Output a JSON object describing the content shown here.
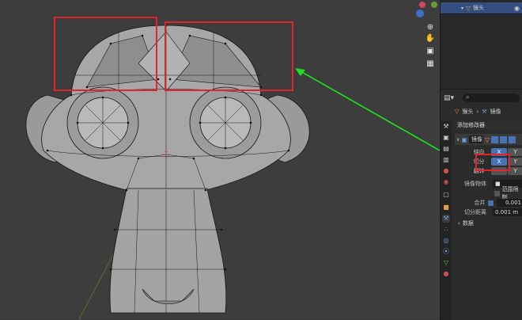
{
  "outliner": {
    "row_label": "猴头"
  },
  "properties": {
    "breadcrumb": {
      "object": "猴头",
      "modifier": "镜像"
    },
    "add_modifier_label": "添加修改器",
    "modifier": {
      "name": "镜像",
      "rows": {
        "axis": {
          "label": "轴向",
          "x": "X",
          "y": "Y"
        },
        "bisect": {
          "label": "切分",
          "x": "X",
          "y": "Y"
        },
        "flip": {
          "label": "翻转",
          "y": "Y"
        }
      },
      "mirror_object_label": "镜像物体",
      "clipping_label": "范围限制",
      "merge_label": "合并",
      "merge_value": "0.001",
      "bisect_distance_label": "切分距离",
      "bisect_distance_value": "0.001 m",
      "data_label": "数据"
    }
  },
  "colors": {
    "annotation": "#e0242a",
    "arrow": "#1ee01e",
    "active_button": "#4772b3",
    "mesh_face": "#a4a4a4",
    "viewport_bg": "#3d3d3d"
  },
  "icons": [
    "search-icon",
    "zoom-icon",
    "hand-icon",
    "camera-icon",
    "grid-icon",
    "modifier-wrench-icon",
    "mesh-icon",
    "eye-icon",
    "editor-type-icon"
  ]
}
